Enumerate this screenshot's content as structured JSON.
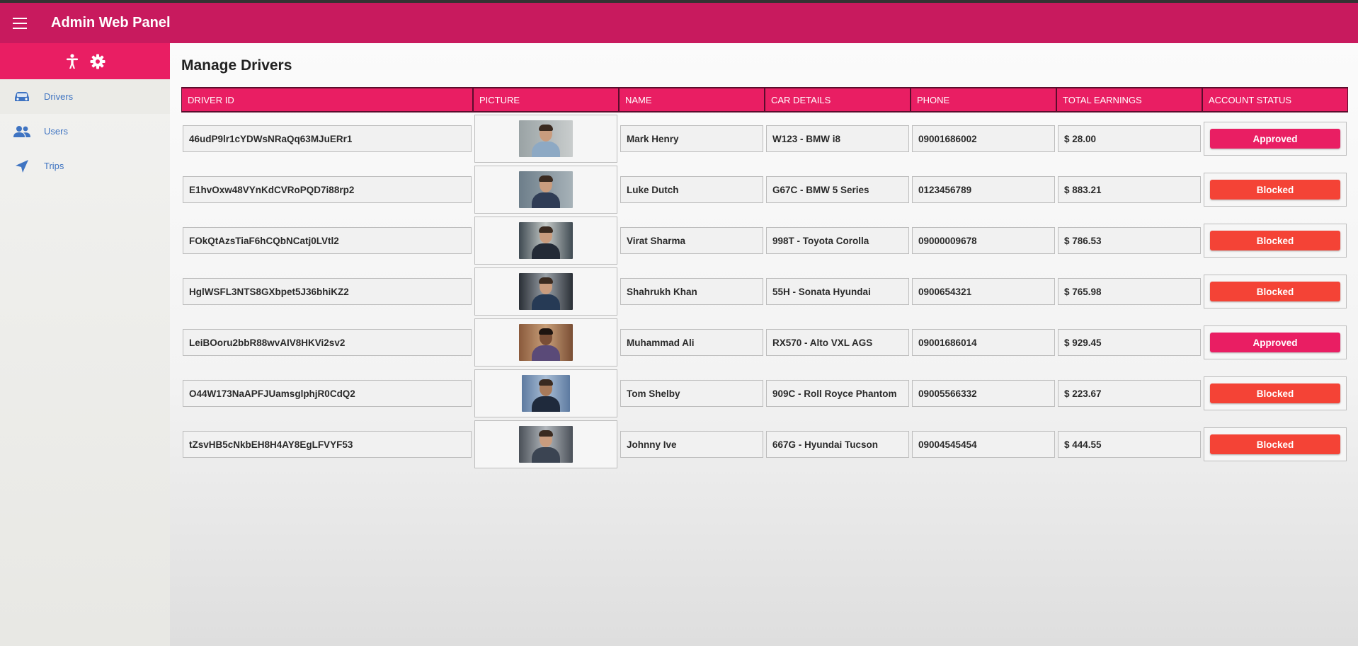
{
  "app": {
    "title": "Admin Web Panel"
  },
  "sidebar": {
    "header_icons": [
      "accessibility-icon",
      "gear-icon"
    ],
    "items": [
      {
        "label": "Drivers",
        "icon": "car-icon"
      },
      {
        "label": "Users",
        "icon": "users-icon"
      },
      {
        "label": "Trips",
        "icon": "navigation-icon"
      }
    ]
  },
  "page": {
    "title": "Manage Drivers"
  },
  "table": {
    "columns": [
      "DRIVER ID",
      "PICTURE",
      "NAME",
      "CAR DETAILS",
      "PHONE",
      "TOTAL EARNINGS",
      "ACCOUNT STATUS"
    ],
    "rows": [
      {
        "driver_id": "46udP9lr1cYDWsNRaQq63MJuERr1",
        "name": "Mark Henry",
        "car": "W123 - BMW i8",
        "phone": "09001686002",
        "earnings": "$ 28.00",
        "status": "Approved"
      },
      {
        "driver_id": "E1hvOxw48VYnKdCVRoPQD7i88rp2",
        "name": "Luke Dutch",
        "car": "G67C - BMW 5 Series",
        "phone": "0123456789",
        "earnings": "$ 883.21",
        "status": "Blocked"
      },
      {
        "driver_id": "FOkQtAzsTiaF6hCQbNCatj0LVtl2",
        "name": "Virat Sharma",
        "car": "998T - Toyota Corolla",
        "phone": "09000009678",
        "earnings": "$ 786.53",
        "status": "Blocked"
      },
      {
        "driver_id": "HglWSFL3NTS8GXbpet5J36bhiKZ2",
        "name": "Shahrukh Khan",
        "car": "55H - Sonata Hyundai",
        "phone": "0900654321",
        "earnings": "$ 765.98",
        "status": "Blocked"
      },
      {
        "driver_id": "LeiBOoru2bbR88wvAIV8HKVi2sv2",
        "name": "Muhammad Ali",
        "car": "RX570 - Alto VXL AGS",
        "phone": "09001686014",
        "earnings": "$ 929.45",
        "status": "Approved"
      },
      {
        "driver_id": "O44W173NaAPFJUamsglphjR0CdQ2",
        "name": "Tom Shelby",
        "car": "909C - Roll Royce Phantom",
        "phone": "09005566332",
        "earnings": "$ 223.67",
        "status": "Blocked"
      },
      {
        "driver_id": "tZsvHB5cNkbEH8H4AY8EgLFVYF53",
        "name": "Johnny Ive",
        "car": "667G - Hyundai Tucson",
        "phone": "09004545454",
        "earnings": "$ 444.55",
        "status": "Blocked"
      }
    ]
  },
  "colors": {
    "appbar": "#c81a5e",
    "accent": "#e91e63",
    "approved": "#e91e63",
    "blocked": "#f44336",
    "link": "#3f74c2"
  }
}
